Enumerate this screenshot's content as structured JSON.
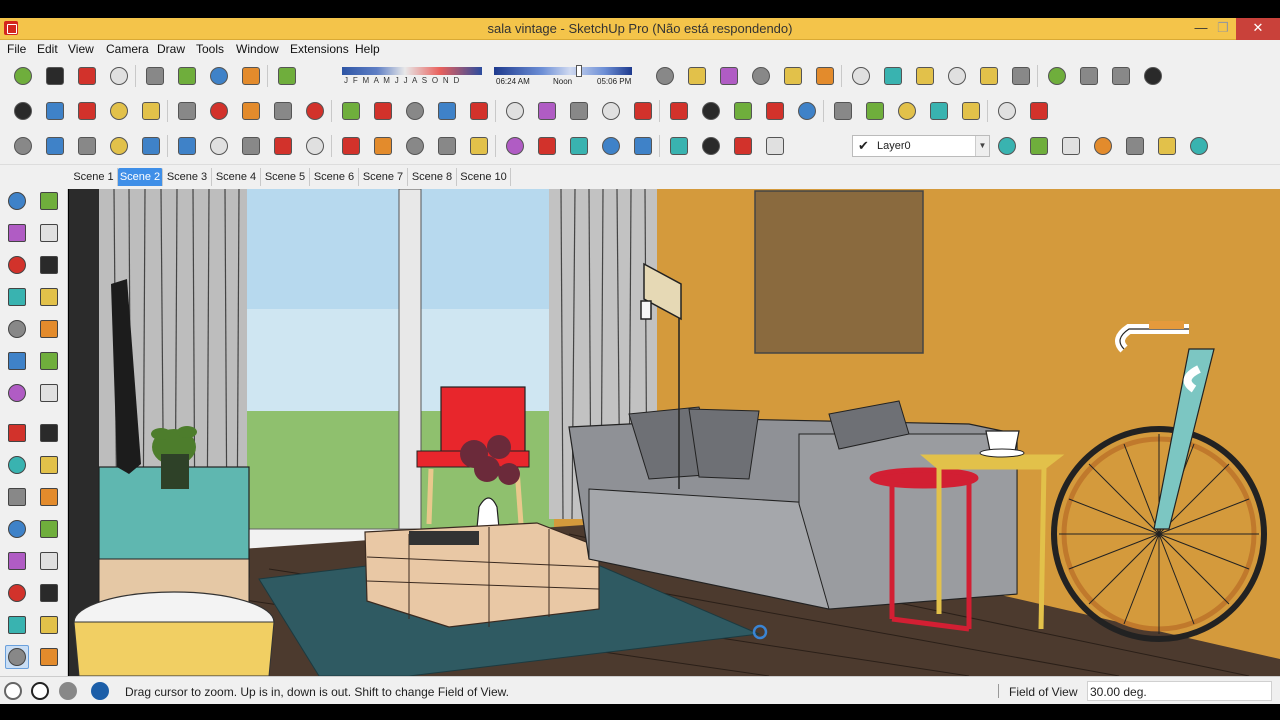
{
  "window": {
    "title": "sala vintage - SketchUp Pro (Não está respondendo)",
    "minimize_glyph": "—",
    "maximize_glyph": "❐",
    "close_glyph": "✕"
  },
  "menu": {
    "items": [
      "File",
      "Edit",
      "View",
      "Camera",
      "Draw",
      "Tools",
      "Window",
      "Extensions",
      "Help"
    ]
  },
  "shadows": {
    "months": "J F M A M J J A S O N D",
    "time_start": "06:24 AM",
    "time_noon": "Noon",
    "time_end": "05:06 PM"
  },
  "layers": {
    "current": "Layer0",
    "check_glyph": "✔",
    "arrow_glyph": "▼"
  },
  "scenes": {
    "tabs": [
      "Scene 1",
      "Scene 2",
      "Scene 3",
      "Scene 4",
      "Scene 5",
      "Scene 6",
      "Scene 7",
      "Scene 8",
      "Scene 10"
    ],
    "active": "Scene 2"
  },
  "status": {
    "hint": "Drag cursor to zoom.  Up is in, down is out. Shift to change Field of View.",
    "vcb_label": "Field of View",
    "vcb_value": "30.00 deg."
  },
  "colors": {
    "titlebar": "#f4c44a",
    "active_scene_tab": "#3f8fe8",
    "wall": "#d49a3c",
    "chair": "#e8262c",
    "sofa": "#8f9196",
    "rug": "#2f5a62",
    "cabinet": "#5fb7b0"
  },
  "icons": {
    "toolbar_row1": [
      "new-model-icon",
      "open-icon",
      "save-icon",
      "make-component-icon",
      "paint-bucket-icon",
      "xray-icon",
      "help-icon",
      "shadows-toggle-icon",
      "fog-icon",
      "front-view-icon",
      "right-view-icon",
      "top-view-icon",
      "back-view-icon",
      "left-view-icon",
      "iso-view-icon",
      "section-plane-icon",
      "display-section-icon",
      "section-cut-icon",
      "section-fill-icon",
      "component-options-icon",
      "dynamic-attrs-icon",
      "generate-report-icon",
      "extension-warehouse-icon",
      "ruby-console-icon",
      "layout-icon"
    ],
    "toolbar_row2": [
      "select-tool-icon",
      "push-pull-icon",
      "move-icon",
      "rotate-icon",
      "follow-me-icon",
      "scale-icon",
      "offset-icon",
      "undo-icon",
      "redo-icon",
      "erase-icon",
      "wireframe-icon",
      "hidden-line-icon",
      "shaded-icon",
      "shaded-textures-icon",
      "monochrome-icon",
      "xray-style-icon",
      "back-edges-icon",
      "outer-shell-icon",
      "intersect-icon",
      "union-icon",
      "subtract-icon",
      "trim-icon",
      "split-icon",
      "sandbox-icon",
      "material-icon",
      "color-icon",
      "section-plane-red-icon",
      "section-plane-blue-icon",
      "section-plane-gray-icon",
      "walk-icon",
      "position-camera-icon",
      "look-around-icon"
    ],
    "toolbar_row3": [
      "components-icon",
      "materials-icon",
      "styles-icon",
      "layers-icon",
      "outliner-icon",
      "m-icon",
      "tag-icon",
      "r-icon",
      "rt-icon",
      "br-icon",
      "question-icon",
      "ticket-icon",
      "sphere-icon",
      "dimension-icon",
      "landscape-icon",
      "terrain-icon",
      "target-icon",
      "pause-icon",
      "light-bulb-icon",
      "pin-icon",
      "flag-icon",
      "bulb-icon",
      "lamp-icon",
      "spot-icon",
      "layer-settings-icon",
      "ar-icon",
      "a-icon",
      "av-icon",
      "an-icon",
      "ax-icon",
      "af-icon"
    ],
    "palette": [
      "select-arrow-icon",
      "make-component-icon",
      "paint-bucket-icon",
      "eraser-icon",
      "pencil-icon",
      "freehand-icon",
      "rectangle-icon",
      "rotated-rectangle-icon",
      "circle-icon",
      "polygon-icon",
      "arc-icon",
      "pie-icon",
      "two-point-arc-icon",
      "three-point-arc-icon",
      "move-tool-icon",
      "push-pull-tool-icon",
      "rotate-tool-icon",
      "follow-me-tool-icon",
      "scale-tool-icon",
      "offset-tool-icon",
      "tape-measure-icon",
      "dimension-tool-icon",
      "protractor-icon",
      "text-tool-icon",
      "axes-tool-icon",
      "3d-text-icon",
      "orbit-icon",
      "pan-icon",
      "zoom-icon",
      "zoom-window-icon"
    ],
    "status": [
      "geo-location-icon",
      "credits-icon",
      "user-icon",
      "instructor-icon"
    ]
  }
}
